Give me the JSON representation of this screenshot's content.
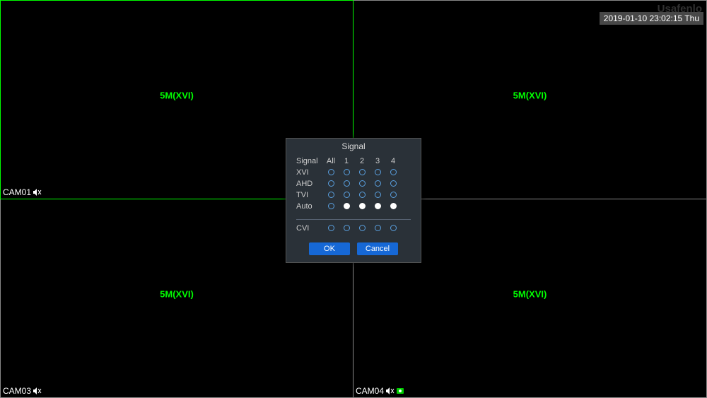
{
  "watermark": "Usafenlo",
  "timestamp": "2019-01-10 23:02:15 Thu",
  "panes": [
    {
      "res": "5M(XVI)",
      "cam": "CAM01"
    },
    {
      "res": "5M(XVI)",
      "cam": ""
    },
    {
      "res": "5M(XVI)",
      "cam": "CAM03"
    },
    {
      "res": "5M(XVI)",
      "cam": "CAM04"
    }
  ],
  "dialog": {
    "title": "Signal",
    "header": {
      "label": "Signal",
      "cols": [
        "All",
        "1",
        "2",
        "3",
        "4"
      ]
    },
    "rows": [
      {
        "label": "XVI",
        "sel": [
          false,
          false,
          false,
          false,
          false
        ]
      },
      {
        "label": "AHD",
        "sel": [
          false,
          false,
          false,
          false,
          false
        ]
      },
      {
        "label": "TVI",
        "sel": [
          false,
          false,
          false,
          false,
          false
        ]
      },
      {
        "label": "Auto",
        "sel": [
          false,
          true,
          true,
          true,
          true
        ]
      }
    ],
    "cvi": {
      "label": "CVI",
      "sel": [
        false,
        false,
        false,
        false,
        false
      ]
    },
    "ok": "OK",
    "cancel": "Cancel"
  }
}
